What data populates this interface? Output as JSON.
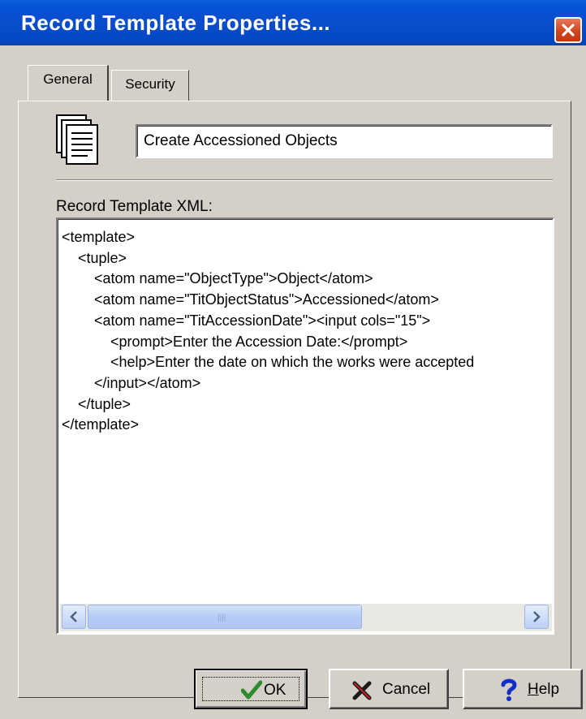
{
  "window": {
    "title": "Record Template Properties..."
  },
  "tabs": [
    {
      "label": "General",
      "selected": true
    },
    {
      "label": "Security",
      "selected": false
    }
  ],
  "template_name": {
    "value": "Create Accessioned Objects"
  },
  "xml_section": {
    "label": "Record Template XML:",
    "content": "<template>\n    <tuple>\n        <atom name=\"ObjectType\">Object</atom>\n        <atom name=\"TitObjectStatus\">Accessioned</atom>\n        <atom name=\"TitAccessionDate\"><input cols=\"15\">\n            <prompt>Enter the Accession Date:</prompt>\n            <help>Enter the date on which the works were accepted\n        </input></atom>\n    </tuple>\n</template>"
  },
  "scrollbar": {
    "position": 0.0,
    "visible_fraction": 0.63
  },
  "buttons": {
    "ok": "OK",
    "cancel": "Cancel",
    "help": "Help"
  },
  "icons": {
    "document": "document-stack-icon",
    "ok": "checkmark-icon",
    "cancel": "x-icon",
    "help": "question-icon",
    "close": "close-icon"
  },
  "colors": {
    "titlebar": "#0a4dcb",
    "dialog_bg": "#d4d0c8",
    "close_button": "#d2461c",
    "ok_check": "#2e8b2e",
    "cancel_x": "#1a1a1a",
    "help_question": "#1030c8"
  }
}
